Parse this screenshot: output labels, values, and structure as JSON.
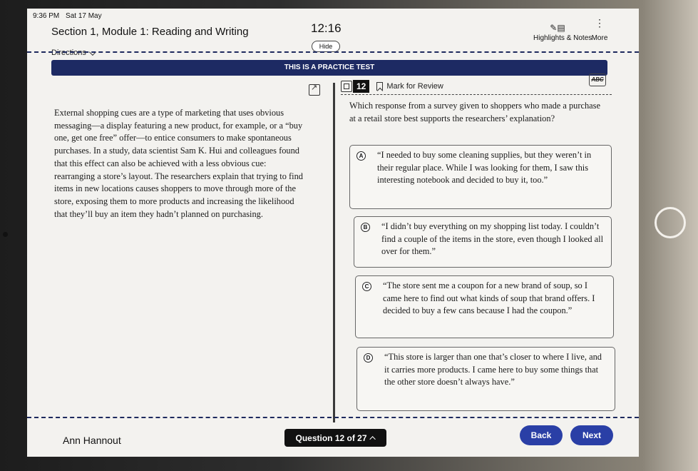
{
  "status_bar": {
    "time": "9:36 PM",
    "date": "Sat 17 May"
  },
  "header": {
    "section_title": "Section 1, Module 1: Reading and Writing",
    "directions_label": "Directions",
    "timer": "12:16",
    "hide_label": "Hide",
    "highlights_label": "Highlights & Notes",
    "more_label": "More"
  },
  "banner": {
    "text": "THIS IS A PRACTICE TEST"
  },
  "passage": {
    "text": "External shopping cues are a type of marketing that uses obvious messaging—a display featuring a new product, for example, or a “buy one, get one free” offer—to entice consumers to make spontaneous purchases. In a study, data scientist Sam K. Hui and colleagues found that this effect can also be achieved with a less obvious cue: rearranging a store’s layout. The researchers explain that trying to find items in new locations causes shoppers to move through more of the store, exposing them to more products and increasing the likelihood that they’ll buy an item they hadn’t planned on purchasing."
  },
  "question": {
    "number": "12",
    "mark_label": "Mark for Review",
    "abc_label": "ABC",
    "prompt": "Which response from a survey given to shoppers who made a purchase at a retail store best supports the researchers’ explanation?",
    "choices": [
      {
        "letter": "A",
        "text": "“I needed to buy some cleaning supplies, but they weren’t in their regular place. While I was looking for them, I saw this interesting notebook and decided to buy it, too.”"
      },
      {
        "letter": "B",
        "text": "“I didn’t buy everything on my shopping list today. I couldn’t find a couple of the items in the store, even though I looked all over for them.”"
      },
      {
        "letter": "C",
        "text": "“The store sent me a coupon for a new brand of soup, so I came here to find out what kinds of soup that brand offers. I decided to buy a few cans because I had the coupon.”"
      },
      {
        "letter": "D",
        "text": "“This store is larger than one that’s closer to where I live, and it carries more products. I came here to buy some things that the other store doesn’t always have.”"
      }
    ]
  },
  "footer": {
    "user_name": "Ann Hannout",
    "question_nav": "Question 12 of 27",
    "back_label": "Back",
    "next_label": "Next"
  },
  "icons": {
    "annotate": "pencil-note-icon",
    "more": "vertical-dots-icon",
    "expand": "expand-icon",
    "collapse": "collapse-icon",
    "bookmark": "bookmark-icon",
    "strikethrough": "abc-strikethrough-icon"
  },
  "colors": {
    "banner_bg": "#1d2a63",
    "nav_button": "#2a3fa6",
    "question_number_bg": "#111111"
  }
}
